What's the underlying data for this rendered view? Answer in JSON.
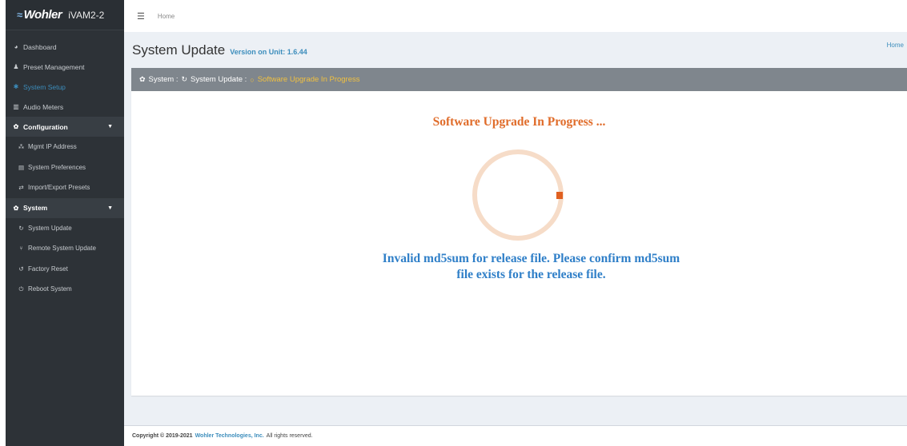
{
  "sidebar": {
    "brand": "Wohler",
    "model": "iVAM2-2",
    "items": [
      {
        "label": "Dashboard",
        "icon": "dashboard-icon"
      },
      {
        "label": "Preset Management",
        "icon": "users-icon"
      },
      {
        "label": "System Setup",
        "icon": "wrench-icon"
      },
      {
        "label": "Audio Meters",
        "icon": "bar-chart-icon"
      }
    ],
    "config_group": "Configuration",
    "config_items": [
      {
        "label": "Mgmt IP Address",
        "icon": "network-icon"
      },
      {
        "label": "System Preferences",
        "icon": "sliders-icon"
      },
      {
        "label": "Import/Export Presets",
        "icon": "exchange-icon"
      }
    ],
    "system_group": "System",
    "system_items": [
      {
        "label": "System Update",
        "icon": "refresh-icon"
      },
      {
        "label": "Remote System Update",
        "icon": "sitemap-icon"
      },
      {
        "label": "Factory Reset",
        "icon": "undo-icon"
      },
      {
        "label": "Reboot System",
        "icon": "power-icon"
      }
    ]
  },
  "topbar": {
    "breadcrumb": "Home"
  },
  "header": {
    "title": "System Update",
    "subtitle": "Version on Unit: 1.6.44",
    "home_link": "Home"
  },
  "box": {
    "crumb_system": "System :",
    "crumb_update": "System Update :",
    "crumb_current": "Software Upgrade In Progress"
  },
  "status": {
    "progress_title": "Software Upgrade In Progress ...",
    "error_line1": "Invalid md5sum for release file. Please confirm md5sum",
    "error_line2": "file exists for the release file."
  },
  "footer": {
    "copyright": "Copyright © 2019-2021",
    "company": "Wohler Technologies, Inc.",
    "rights": "All rights reserved."
  },
  "colors": {
    "accent": "#3c8dbc",
    "progress_title": "#e06c2a",
    "error_text": "#2f7fc8",
    "spinner_ring": "#f6dcc8",
    "spinner_head": "#e06020"
  }
}
